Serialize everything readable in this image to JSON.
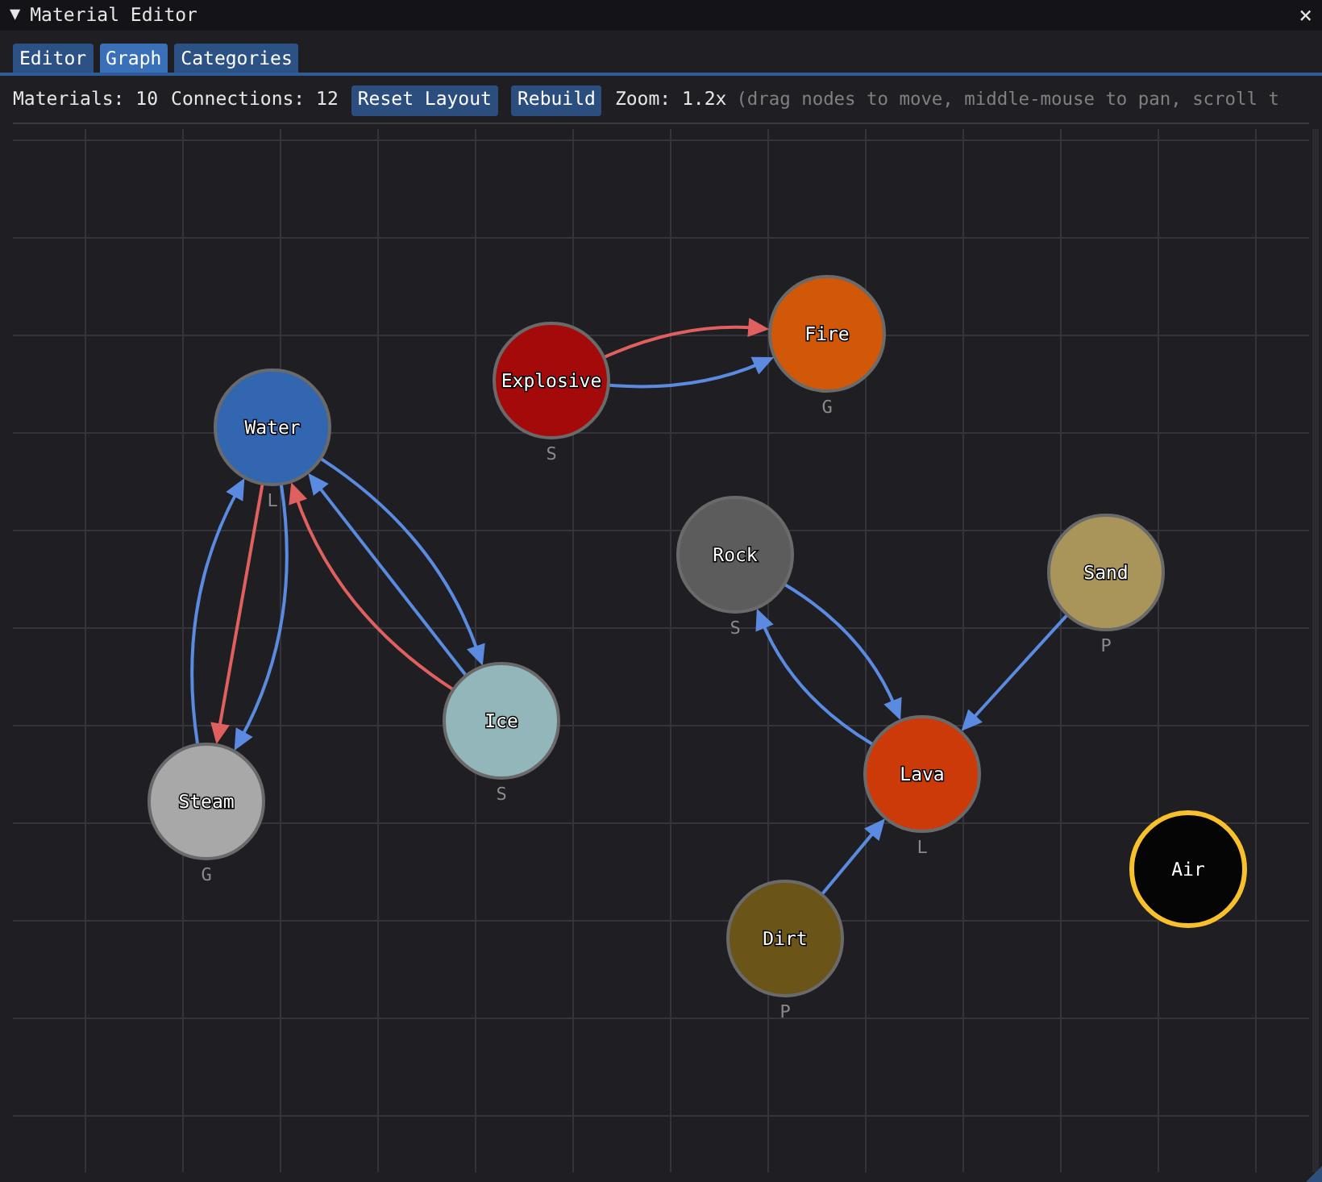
{
  "window": {
    "title": "Material Editor",
    "collapse_glyph": "▼",
    "close_glyph": "×"
  },
  "tabs": [
    {
      "label": "Editor",
      "selected": false
    },
    {
      "label": "Graph",
      "selected": true
    },
    {
      "label": "Categories",
      "selected": false
    }
  ],
  "toolbar": {
    "materials": "Materials: 10",
    "connections": "Connections: 12",
    "buttons": [
      "Reset Layout",
      "Rebuild"
    ],
    "zoom": "Zoom: 1.2x",
    "hint": "(drag nodes to move, middle-mouse to pan, scroll t"
  },
  "graph": {
    "nodes": [
      {
        "name": "Explosive",
        "phase": "S",
        "color": "#a50a0a",
        "selected": false
      },
      {
        "name": "Fire",
        "phase": "G",
        "color": "#d05808",
        "selected": false
      },
      {
        "name": "Water",
        "phase": "L",
        "color": "#3366b0",
        "selected": false
      },
      {
        "name": "Rock",
        "phase": "S",
        "color": "#5c5c5c",
        "selected": false
      },
      {
        "name": "Sand",
        "phase": "P",
        "color": "#a9955a",
        "selected": false
      },
      {
        "name": "Ice",
        "phase": "S",
        "color": "#92b6ba",
        "selected": false
      },
      {
        "name": "Steam",
        "phase": "G",
        "color": "#a8a8a8",
        "selected": false
      },
      {
        "name": "Lava",
        "phase": "L",
        "color": "#cb3a08",
        "selected": false
      },
      {
        "name": "Dirt",
        "phase": "P",
        "color": "#6b5418",
        "selected": false
      },
      {
        "name": "Air",
        "color": "#050505",
        "selected": true
      }
    ],
    "edges": [
      {
        "color": "#e06060"
      },
      {
        "color": "#5b8be0"
      },
      {
        "color": "#5b8be0"
      },
      {
        "color": "#5b8be0"
      },
      {
        "color": "#e06060"
      },
      {
        "color": "#e06060"
      },
      {
        "color": "#5b8be0"
      },
      {
        "color": "#5b8be0"
      },
      {
        "color": "#5b8be0"
      },
      {
        "color": "#5b8be0"
      },
      {
        "color": "#5b8be0"
      },
      {
        "color": "#5b8be0"
      }
    ]
  }
}
